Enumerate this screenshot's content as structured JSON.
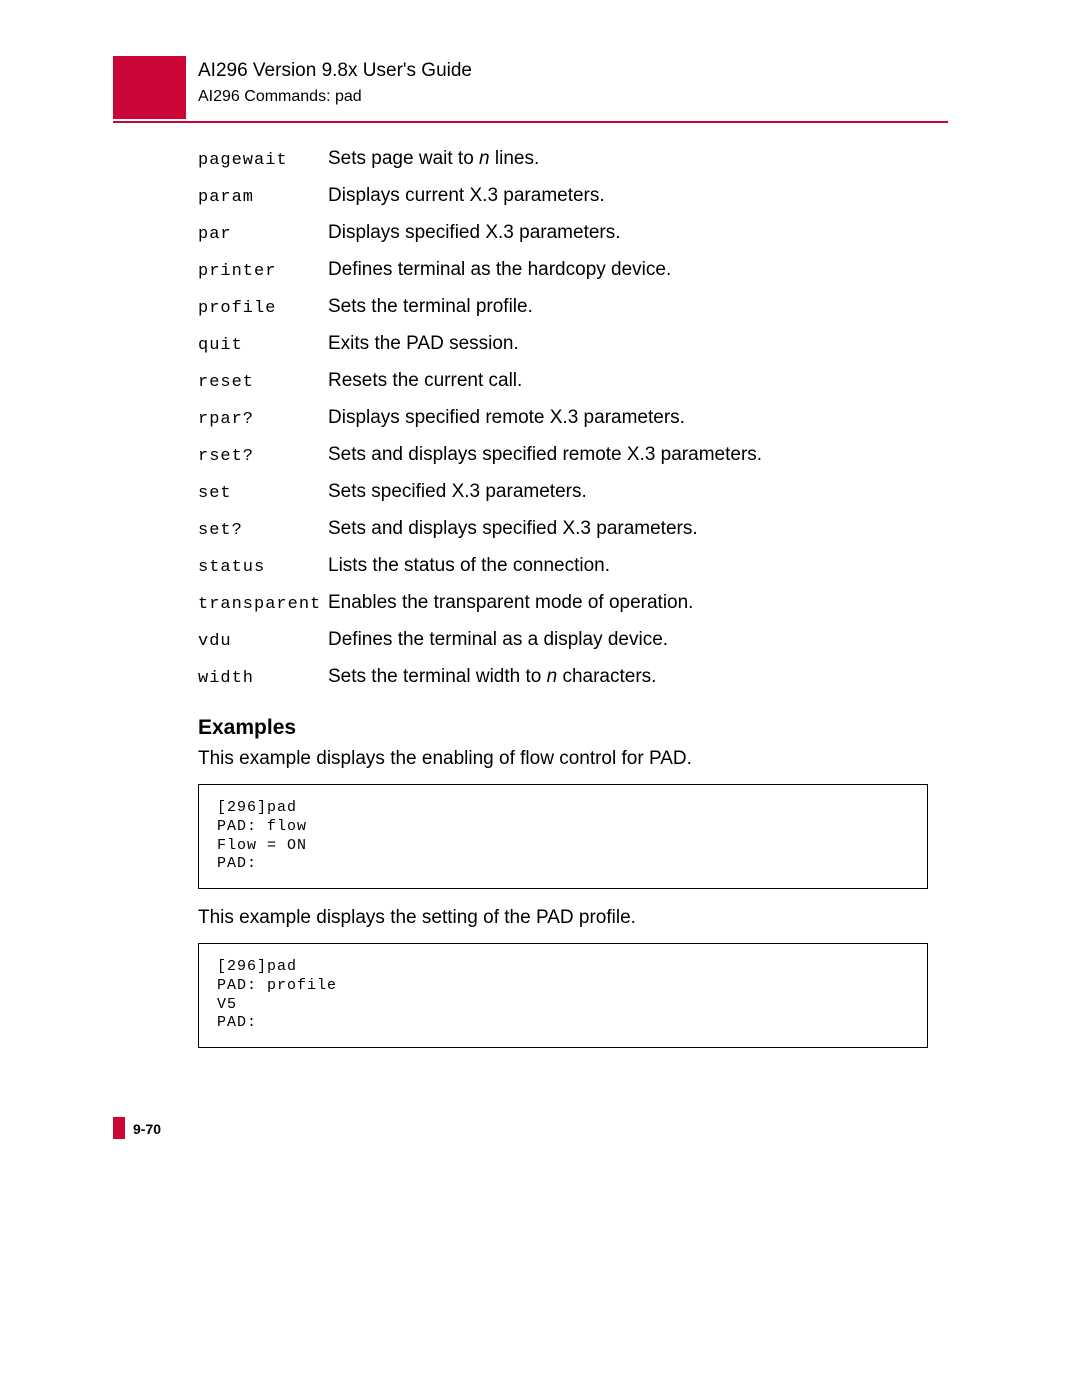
{
  "header": {
    "title": "AI296 Version 9.8x User's Guide",
    "subtitle": "AI296 Commands: pad"
  },
  "commands": [
    {
      "name": "pagewait",
      "desc_pre": "Sets page wait to ",
      "ital": "n",
      "desc_post": " lines."
    },
    {
      "name": "param",
      "desc_pre": "Displays current X.3 parameters.",
      "ital": "",
      "desc_post": ""
    },
    {
      "name": "par",
      "desc_pre": "Displays specified X.3 parameters.",
      "ital": "",
      "desc_post": ""
    },
    {
      "name": "printer",
      "desc_pre": "Defines terminal as the hardcopy device.",
      "ital": "",
      "desc_post": ""
    },
    {
      "name": "profile",
      "desc_pre": "Sets the terminal profile.",
      "ital": "",
      "desc_post": ""
    },
    {
      "name": "quit",
      "desc_pre": "Exits the PAD session.",
      "ital": "",
      "desc_post": ""
    },
    {
      "name": "reset",
      "desc_pre": "Resets the current call.",
      "ital": "",
      "desc_post": ""
    },
    {
      "name": "rpar?",
      "desc_pre": "Displays specified remote X.3 parameters.",
      "ital": "",
      "desc_post": ""
    },
    {
      "name": "rset?",
      "desc_pre": "Sets and displays specified remote X.3 parameters.",
      "ital": "",
      "desc_post": ""
    },
    {
      "name": "set",
      "desc_pre": "Sets specified X.3 parameters.",
      "ital": "",
      "desc_post": ""
    },
    {
      "name": "set?",
      "desc_pre": "Sets and displays specified X.3 parameters.",
      "ital": "",
      "desc_post": ""
    },
    {
      "name": "status",
      "desc_pre": "Lists the status of the connection.",
      "ital": "",
      "desc_post": ""
    },
    {
      "name": "transparent",
      "desc_pre": "Enables the transparent mode of operation.",
      "ital": "",
      "desc_post": ""
    },
    {
      "name": "vdu",
      "desc_pre": "Defines the terminal as a display device.",
      "ital": "",
      "desc_post": ""
    },
    {
      "name": "width",
      "desc_pre": "Sets the terminal width to ",
      "ital": "n",
      "desc_post": " characters."
    }
  ],
  "examples": {
    "heading": "Examples",
    "intro1": "This example displays the enabling of flow control for PAD.",
    "code1": "[296]pad\nPAD: flow\nFlow = ON\nPAD:",
    "intro2": "This example displays the setting of the PAD profile.",
    "code2": "[296]pad\nPAD: profile\nV5\nPAD:"
  },
  "footer": {
    "page": "9-70"
  }
}
